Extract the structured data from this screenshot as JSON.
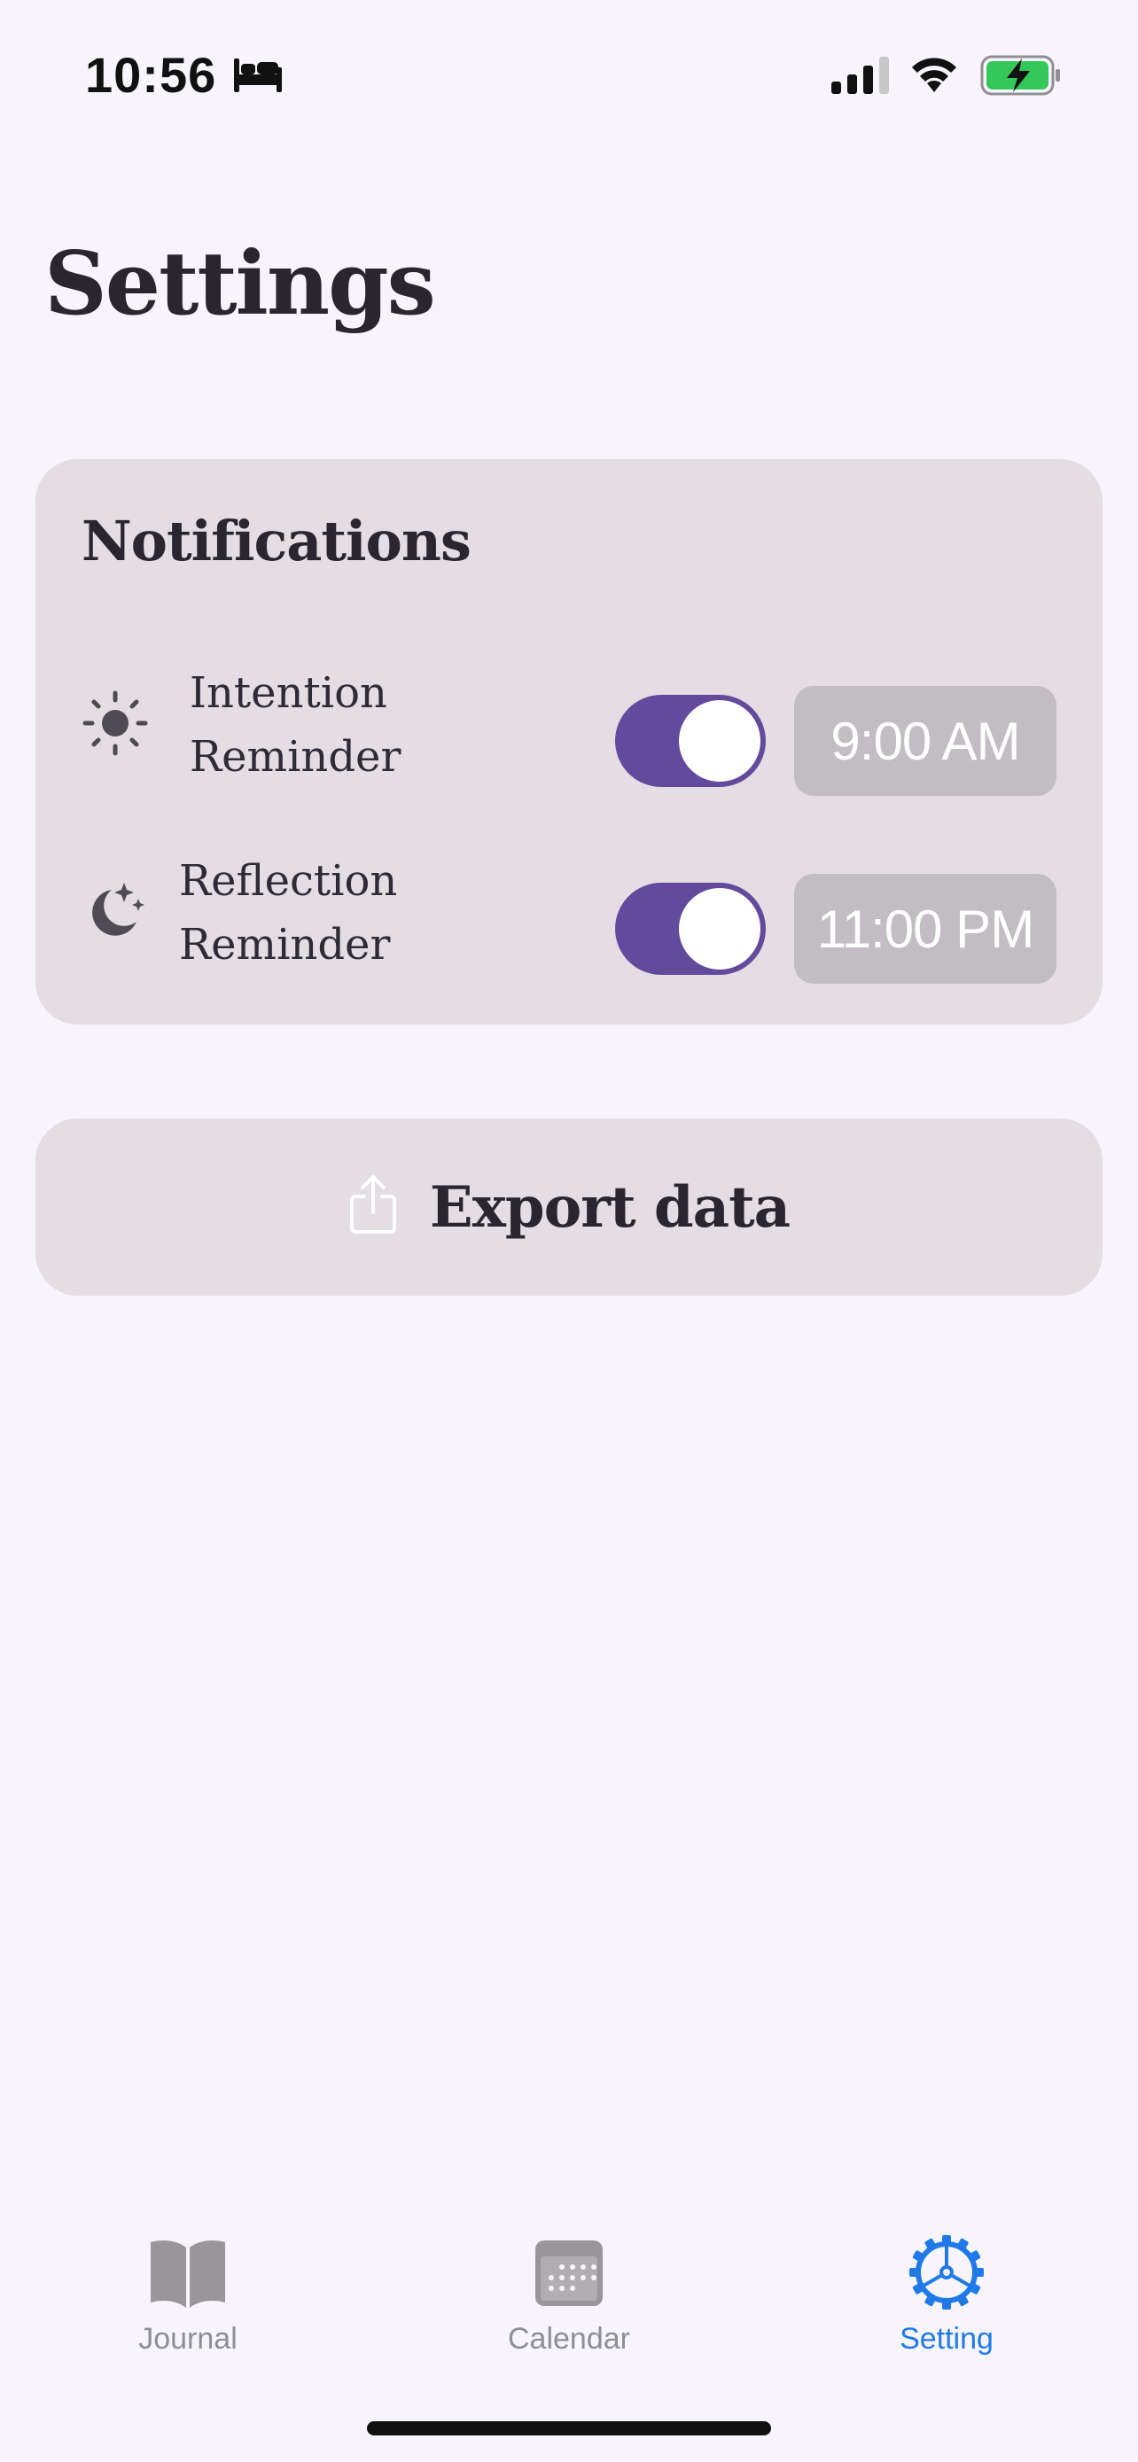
{
  "status_bar": {
    "time": "10:56",
    "icons": [
      "bed-icon",
      "signal-icon",
      "wifi-icon",
      "battery-charging-icon"
    ]
  },
  "page": {
    "title": "Settings"
  },
  "notifications": {
    "title": "Notifications",
    "rows": [
      {
        "icon": "sun-icon",
        "label_line1": "Intention",
        "label_line2": "Reminder",
        "enabled": true,
        "time": "9:00 AM"
      },
      {
        "icon": "moon-stars-icon",
        "label_line1": "Reflection",
        "label_line2": "Reminder",
        "enabled": true,
        "time": "11:00 PM"
      }
    ]
  },
  "export": {
    "icon": "share-icon",
    "label": "Export data"
  },
  "tab_bar": {
    "items": [
      {
        "icon": "book-icon",
        "label": "Journal",
        "active": false
      },
      {
        "icon": "calendar-icon",
        "label": "Calendar",
        "active": false
      },
      {
        "icon": "gear-icon",
        "label": "Setting",
        "active": true
      }
    ]
  },
  "colors": {
    "background": "#f7f4fc",
    "card": "#e4dde3",
    "toggle_on": "#634a9c",
    "time_chip": "#c2bdc3",
    "tab_active": "#1f7ae8",
    "tab_inactive": "#8e8e93"
  }
}
